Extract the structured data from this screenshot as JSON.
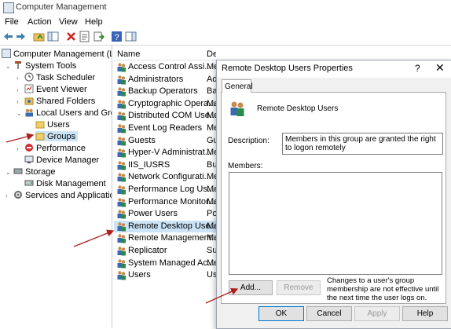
{
  "window": {
    "title": "Computer Management"
  },
  "menu": [
    "File",
    "Action",
    "View",
    "Help"
  ],
  "tree": {
    "root": "Computer Management (Loca",
    "system_tools": "System Tools",
    "task_scheduler": "Task Scheduler",
    "event_viewer": "Event Viewer",
    "shared_folders": "Shared Folders",
    "local_users": "Local Users and Group",
    "users": "Users",
    "groups": "Groups",
    "performance": "Performance",
    "device_manager": "Device Manager",
    "storage": "Storage",
    "disk_management": "Disk Management",
    "services": "Services and Applications"
  },
  "list": {
    "col_name": "Name",
    "col_desc": "Description",
    "rows": [
      {
        "name": "Access Control Assi...",
        "desc": "Me"
      },
      {
        "name": "Administrators",
        "desc": "Ad"
      },
      {
        "name": "Backup Operators",
        "desc": "Ba"
      },
      {
        "name": "Cryptographic Opera...",
        "desc": "Me"
      },
      {
        "name": "Distributed COM Use...",
        "desc": "Me"
      },
      {
        "name": "Event Log Readers",
        "desc": "Me"
      },
      {
        "name": "Guests",
        "desc": "Gu"
      },
      {
        "name": "Hyper-V Administrat...",
        "desc": "Me"
      },
      {
        "name": "IIS_IUSRS",
        "desc": "Bu"
      },
      {
        "name": "Network Configurati...",
        "desc": "Me"
      },
      {
        "name": "Performance Log Us...",
        "desc": "Me"
      },
      {
        "name": "Performance Monitor...",
        "desc": "Me"
      },
      {
        "name": "Power Users",
        "desc": "Po"
      },
      {
        "name": "Remote Desktop Use...",
        "desc": "Me"
      },
      {
        "name": "Remote Management...",
        "desc": "Me"
      },
      {
        "name": "Replicator",
        "desc": "Su"
      },
      {
        "name": "System Managed Ac...",
        "desc": "Me"
      },
      {
        "name": "Users",
        "desc": "Us"
      }
    ]
  },
  "dialog": {
    "title": "Remote Desktop Users Properties",
    "help_glyph": "?",
    "close_glyph": "✕",
    "tab": "General",
    "group_name": "Remote Desktop Users",
    "description_label": "Description:",
    "description_value": "Members in this group are granted the right to logon remotely",
    "members_label": "Members:",
    "add": "Add...",
    "remove": "Remove",
    "note": "Changes to a user's group membership are not effective until the next time the user logs on.",
    "ok": "OK",
    "cancel": "Cancel",
    "apply": "Apply",
    "help": "Help"
  },
  "colors": {
    "selection": "#cce4f7",
    "arrow": "#b01c1c",
    "accent": "#0078d7"
  }
}
